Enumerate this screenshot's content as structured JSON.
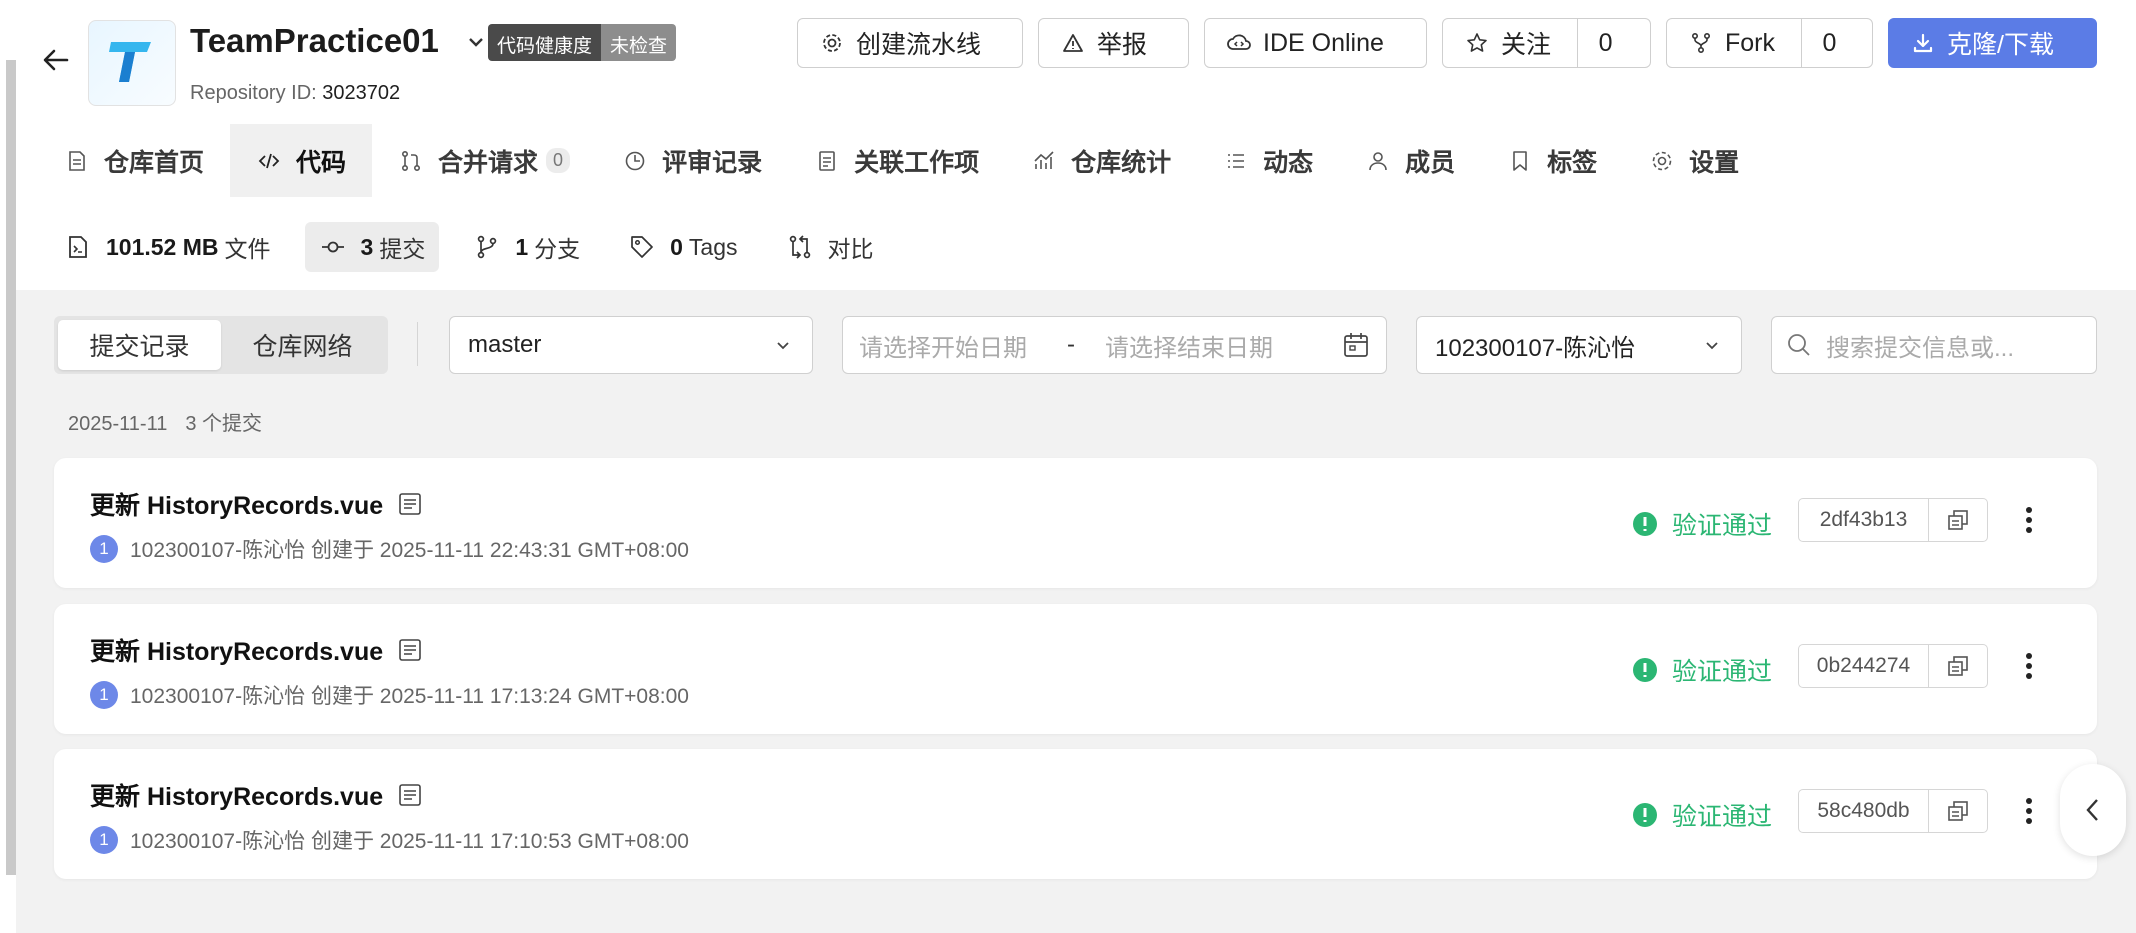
{
  "repo": {
    "name": "TeamPractice01",
    "health_label": "代码健康度",
    "health_status": "未检查",
    "id_label": "Repository ID:",
    "id_value": "3023702"
  },
  "header_buttons": {
    "pipeline": "创建流水线",
    "report": "举报",
    "ide": "IDE Online",
    "follow": "关注",
    "follow_count": "0",
    "fork": "Fork",
    "fork_count": "0",
    "clone": "克隆/下载"
  },
  "tabs": [
    {
      "label": "仓库首页",
      "icon": "file-icon"
    },
    {
      "label": "代码",
      "icon": "code-icon"
    },
    {
      "label": "合并请求",
      "icon": "merge-icon",
      "badge": "0"
    },
    {
      "label": "评审记录",
      "icon": "review-icon"
    },
    {
      "label": "关联工作项",
      "icon": "workitem-icon"
    },
    {
      "label": "仓库统计",
      "icon": "chart-icon"
    },
    {
      "label": "动态",
      "icon": "list-icon"
    },
    {
      "label": "成员",
      "icon": "user-icon"
    },
    {
      "label": "标签",
      "icon": "bookmark-icon"
    },
    {
      "label": "设置",
      "icon": "gear-icon"
    }
  ],
  "stats": {
    "size_value": "101.52 MB",
    "size_label": "文件",
    "commits_value": "3",
    "commits_label": "提交",
    "branches_value": "1",
    "branches_label": "分支",
    "tags_value": "0",
    "tags_label": "Tags",
    "compare_label": "对比"
  },
  "filters": {
    "seg_commits": "提交记录",
    "seg_network": "仓库网络",
    "branch": "master",
    "start_placeholder": "请选择开始日期",
    "date_sep": "-",
    "end_placeholder": "请选择结束日期",
    "author": "102300107-陈沁怡",
    "search_placeholder": "搜索提交信息或..."
  },
  "group": {
    "date": "2025-11-11",
    "count": "3 个提交"
  },
  "commits": [
    {
      "title": "更新 HistoryRecords.vue",
      "num": "1",
      "meta": "102300107-陈沁怡  创建于 2025-11-11 22:43:31 GMT+08:00",
      "status": "验证通过",
      "hash": "2df43b13"
    },
    {
      "title": "更新 HistoryRecords.vue",
      "num": "1",
      "meta": "102300107-陈沁怡  创建于 2025-11-11 17:13:24 GMT+08:00",
      "status": "验证通过",
      "hash": "0b244274"
    },
    {
      "title": "更新 HistoryRecords.vue",
      "num": "1",
      "meta": "102300107-陈沁怡  创建于 2025-11-11 17:10:53 GMT+08:00",
      "status": "验证通过",
      "hash": "58c480db"
    }
  ],
  "colors": {
    "primary": "#5b7ce6",
    "success": "#2bb673"
  }
}
